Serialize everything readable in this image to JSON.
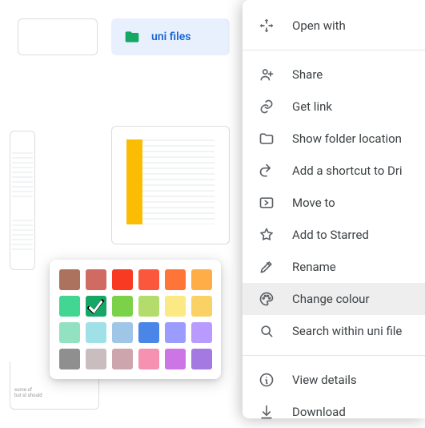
{
  "selected_folder": {
    "label": "uni files",
    "icon_color": "#16a765"
  },
  "menu": {
    "groups": [
      [
        {
          "id": "open-with",
          "label": "Open with",
          "icon": "open-with"
        }
      ],
      [
        {
          "id": "share",
          "label": "Share",
          "icon": "person-add"
        },
        {
          "id": "get-link",
          "label": "Get link",
          "icon": "link"
        },
        {
          "id": "show-location",
          "label": "Show folder location",
          "icon": "folder-outline"
        },
        {
          "id": "add-shortcut",
          "label": "Add a shortcut to Dri",
          "icon": "shortcut"
        },
        {
          "id": "move-to",
          "label": "Move to",
          "icon": "move"
        },
        {
          "id": "add-starred",
          "label": "Add to Starred",
          "icon": "star"
        },
        {
          "id": "rename",
          "label": "Rename",
          "icon": "rename"
        },
        {
          "id": "change-colour",
          "label": "Change colour",
          "icon": "palette",
          "highlight": true
        },
        {
          "id": "search-within",
          "label": "Search within uni file",
          "icon": "search"
        }
      ],
      [
        {
          "id": "view-details",
          "label": "View details",
          "icon": "info"
        },
        {
          "id": "download",
          "label": "Download",
          "icon": "download"
        }
      ]
    ]
  },
  "color_picker": {
    "selected_index": 7,
    "colors": [
      "#ac725e",
      "#d06b64",
      "#f83a22",
      "#fa573c",
      "#ff7537",
      "#ffad46",
      "#42d692",
      "#16a765",
      "#7bd148",
      "#b3dc6c",
      "#fbe983",
      "#fad165",
      "#92e1c0",
      "#9fe1e7",
      "#9fc6e7",
      "#4986e7",
      "#9a9cff",
      "#b99aff",
      "#8f8f8f",
      "#cabdbf",
      "#cca6ac",
      "#f691b2",
      "#cd74e6",
      "#a47ae2"
    ]
  }
}
